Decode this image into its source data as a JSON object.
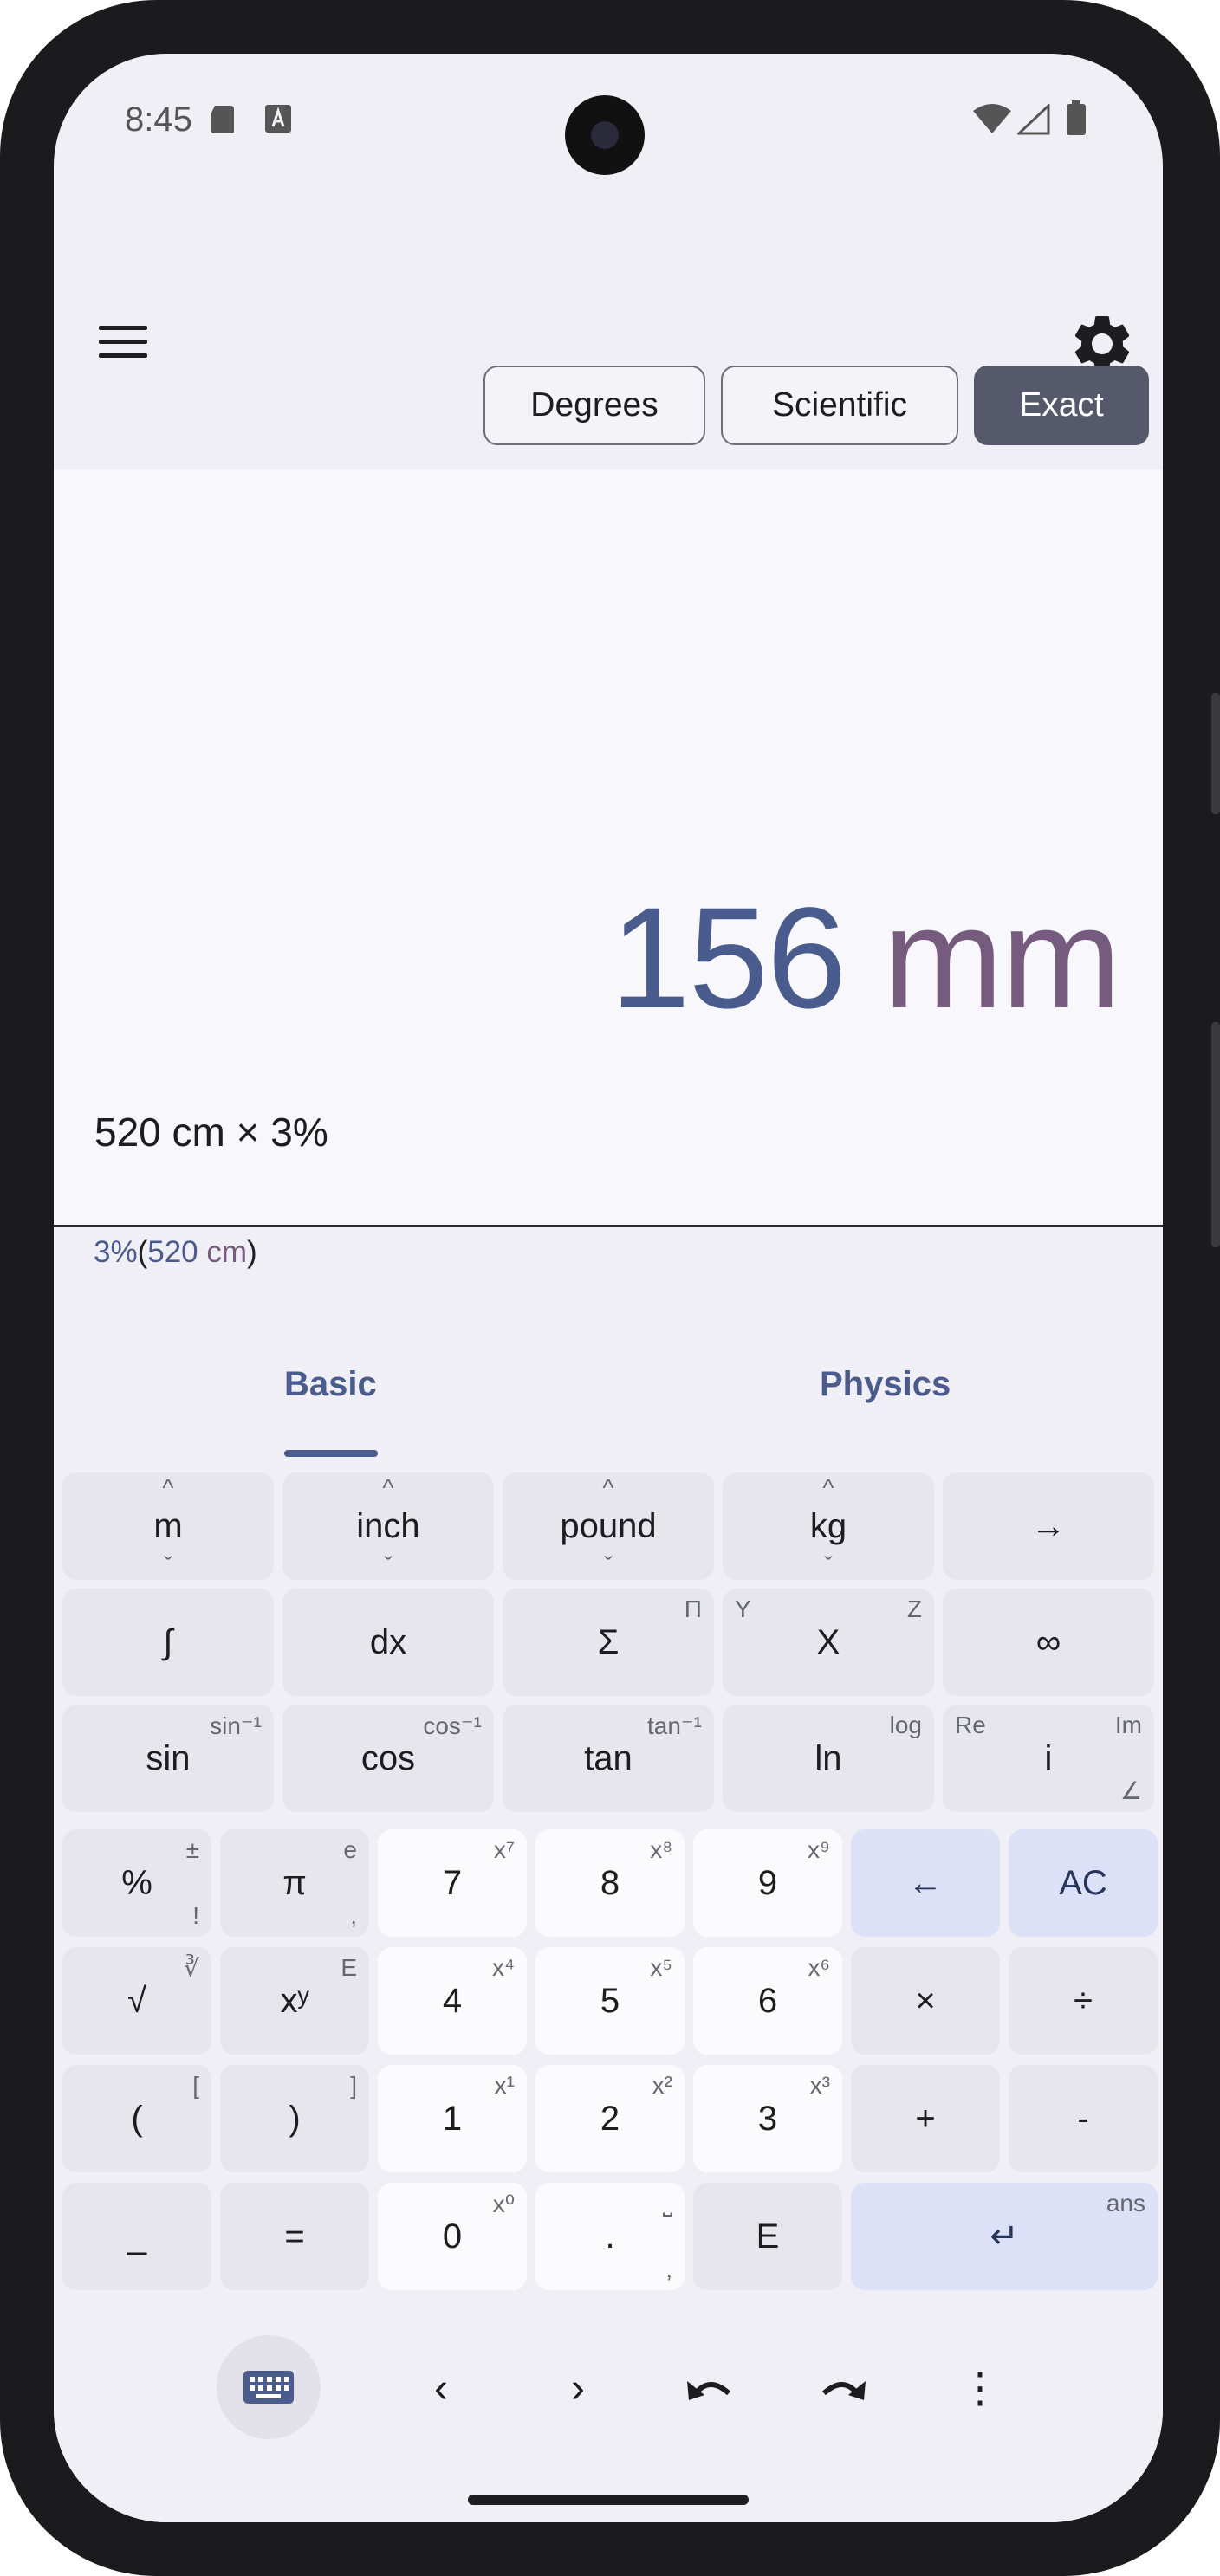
{
  "status": {
    "time": "8:45"
  },
  "toolbar": {
    "modes": [
      {
        "label": "Degrees",
        "active": false
      },
      {
        "label": "Scientific",
        "active": false
      },
      {
        "label": "Exact",
        "active": true
      }
    ]
  },
  "display": {
    "result_value": "156",
    "result_unit": "mm",
    "expression": "520 cm × 3%",
    "preview_num1": "3%",
    "preview_open": "(",
    "preview_num2": "520",
    "preview_unit": "cm",
    "preview_close": ")"
  },
  "tabs": [
    {
      "label": "Basic",
      "selected": true
    },
    {
      "label": "Physics",
      "selected": false
    }
  ],
  "keys": {
    "m": {
      "main": "m",
      "up": "^",
      "down": "ˇ"
    },
    "inch": {
      "main": "inch",
      "up": "^",
      "down": "ˇ"
    },
    "pound": {
      "main": "pound",
      "up": "^",
      "down": "ˇ"
    },
    "kg": {
      "main": "kg",
      "up": "^",
      "down": "ˇ"
    },
    "arrow": {
      "main": "→"
    },
    "integral": {
      "main": "∫"
    },
    "dx": {
      "main": "dx"
    },
    "sigma": {
      "main": "Σ",
      "tr": "Π"
    },
    "X": {
      "main": "X",
      "tl": "Y",
      "tr": "Z"
    },
    "infinity": {
      "main": "∞"
    },
    "sin": {
      "main": "sin",
      "tr": "sin⁻¹"
    },
    "cos": {
      "main": "cos",
      "tr": "cos⁻¹"
    },
    "tan": {
      "main": "tan",
      "tr": "tan⁻¹"
    },
    "ln": {
      "main": "ln",
      "tr": "log"
    },
    "i": {
      "main": "i",
      "tl": "Re",
      "tr": "Im",
      "br": "∠"
    },
    "percent": {
      "main": "%",
      "tr": "±",
      "br": "!"
    },
    "pi": {
      "main": "π",
      "tr": "e",
      "br": ","
    },
    "seven": {
      "main": "7",
      "tr": "x⁷"
    },
    "eight": {
      "main": "8",
      "tr": "x⁸"
    },
    "nine": {
      "main": "9",
      "tr": "x⁹"
    },
    "backspace": {
      "main": "←"
    },
    "ac": {
      "main": "AC"
    },
    "sqrt": {
      "main": "√",
      "tr": "∛"
    },
    "pow": {
      "main": "xʸ",
      "tr": "E"
    },
    "four": {
      "main": "4",
      "tr": "x⁴"
    },
    "five": {
      "main": "5",
      "tr": "x⁵"
    },
    "six": {
      "main": "6",
      "tr": "x⁶"
    },
    "times": {
      "main": "×"
    },
    "divide": {
      "main": "÷"
    },
    "lparen": {
      "main": "(",
      "tr": "["
    },
    "rparen": {
      "main": ")",
      "tr": "]"
    },
    "one": {
      "main": "1",
      "tr": "x¹"
    },
    "two": {
      "main": "2",
      "tr": "x²"
    },
    "three": {
      "main": "3",
      "tr": "x³"
    },
    "plus": {
      "main": "+"
    },
    "minus": {
      "main": "-"
    },
    "underscore": {
      "main": "_"
    },
    "equals": {
      "main": "="
    },
    "zero": {
      "main": "0",
      "tr": "x⁰"
    },
    "dot": {
      "main": ".",
      "tr": "⎵",
      "br": ","
    },
    "E": {
      "main": "E"
    },
    "enter": {
      "main": "↵",
      "tr": "ans"
    }
  },
  "bottom_bar": {
    "left": "‹",
    "right": "›",
    "more": "⋮"
  },
  "colors": {
    "accent": "#4a5b8e",
    "unit": "#765b7e",
    "active_mode": "#55596b",
    "blue_key": "#dce1f8"
  }
}
